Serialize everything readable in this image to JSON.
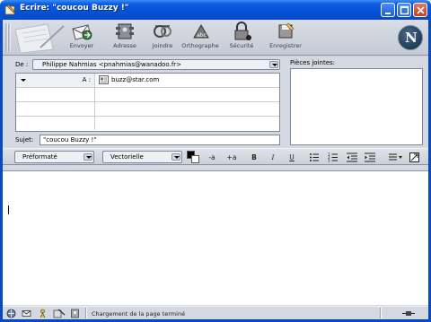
{
  "window": {
    "title": "Ecrire: \"coucou Buzzy !\""
  },
  "toolbar": {
    "buttons": [
      {
        "label": "Envoyer",
        "icon": "send-icon"
      },
      {
        "label": "Adresse",
        "icon": "address-book-icon"
      },
      {
        "label": "Joindre",
        "icon": "attach-icon"
      },
      {
        "label": "Orthographe",
        "icon": "spellcheck-icon"
      },
      {
        "label": "Sécurité",
        "icon": "security-lock-icon"
      },
      {
        "label": "Enregistrer",
        "icon": "save-icon"
      }
    ]
  },
  "header": {
    "from_label": "De :",
    "from_value": "Philippe Nahmias <pnahmias@wanadoo.fr>",
    "recipients": [
      {
        "type": "A :",
        "address": "buzz@star.com"
      }
    ],
    "attachments_label": "Pièces jointes:",
    "subject_label": "Sujet:",
    "subject_value": "\"coucou Buzzy !\""
  },
  "format": {
    "paragraph_style": "Préformaté",
    "font": "Vectorielle",
    "smaller_label": "-a",
    "larger_label": "+a",
    "bold_label": "B",
    "italic_label": "I",
    "underline_label": "U",
    "text_color": "#000000",
    "bg_color": "#ffffff"
  },
  "status": {
    "text": "Chargement de la page terminé"
  }
}
